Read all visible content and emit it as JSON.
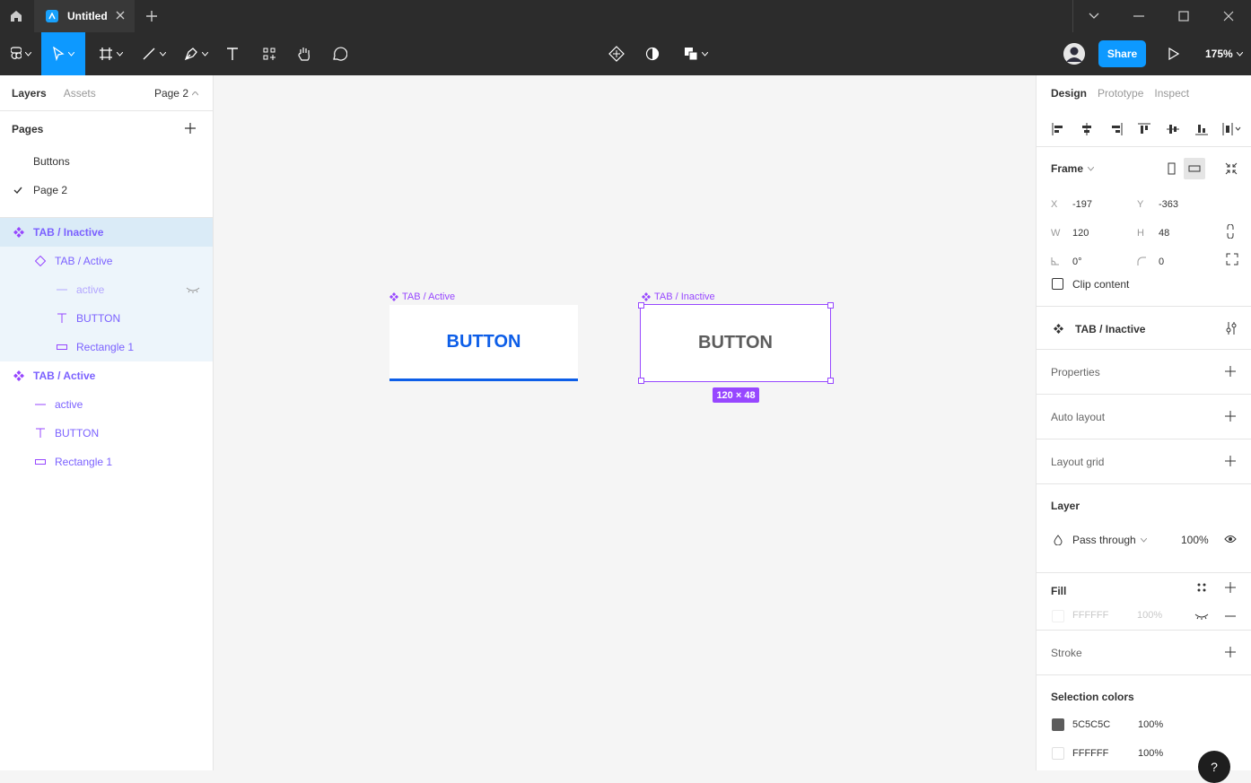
{
  "titlebar": {
    "tab_title": "Untitled"
  },
  "toolbar": {
    "share": "Share",
    "zoom": "175%"
  },
  "left_panel": {
    "tabs": [
      "Layers",
      "Assets"
    ],
    "current_page": "Page 2",
    "pages_title": "Pages",
    "pages": [
      "Buttons",
      "Page 2"
    ],
    "layers": [
      {
        "label": "TAB / Inactive",
        "icon": "component-icon"
      },
      {
        "label": "TAB / Active",
        "icon": "instance-icon"
      },
      {
        "label": "active",
        "icon": "line-icon"
      },
      {
        "label": "BUTTON",
        "icon": "text-icon"
      },
      {
        "label": "Rectangle 1",
        "icon": "rectangle-icon"
      },
      {
        "label": "TAB / Active",
        "icon": "component-icon"
      },
      {
        "label": "active",
        "icon": "line-icon"
      },
      {
        "label": "BUTTON",
        "icon": "text-icon"
      },
      {
        "label": "Rectangle 1",
        "icon": "rectangle-icon"
      }
    ]
  },
  "canvas": {
    "frame_active": {
      "label": "TAB / Active",
      "text": "BUTTON"
    },
    "frame_inactive": {
      "label": "TAB / Inactive",
      "text": "BUTTON"
    },
    "size_badge": "120 × 48"
  },
  "right_panel": {
    "tabs": [
      "Design",
      "Prototype",
      "Inspect"
    ],
    "frame": {
      "title": "Frame",
      "x_label": "X",
      "x": "-197",
      "y_label": "Y",
      "y": "-363",
      "w_label": "W",
      "w": "120",
      "h_label": "H",
      "h": "48",
      "rotation": "0°",
      "radius": "0",
      "clip": "Clip content"
    },
    "component_name": "TAB / Inactive",
    "sections": {
      "properties": "Properties",
      "auto_layout": "Auto layout",
      "layout_grid": "Layout grid",
      "stroke": "Stroke"
    },
    "layer": {
      "title": "Layer",
      "blend": "Pass through",
      "opacity": "100%"
    },
    "fill": {
      "title": "Fill",
      "hex": "FFFFFF",
      "opacity": "100%"
    },
    "selection_colors": {
      "title": "Selection colors",
      "items": [
        {
          "hex": "5C5C5C",
          "opacity": "100%",
          "color": "#5c5c5c"
        },
        {
          "hex": "FFFFFF",
          "opacity": "100%",
          "color": "#ffffff"
        }
      ]
    },
    "help": "?"
  },
  "colors": {
    "accent": "#0d99ff",
    "component": "#9747ff",
    "active_tab": "#0d5ee8"
  }
}
